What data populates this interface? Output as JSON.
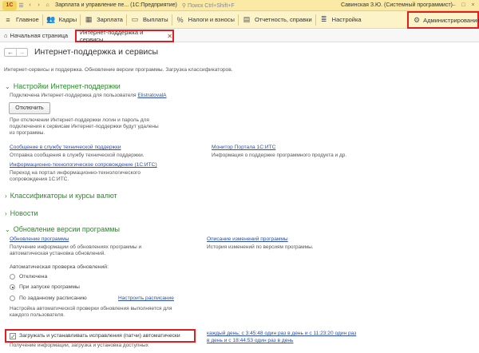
{
  "window": {
    "title": "Зарплата и управление пе... (1С:Предприятие)",
    "search_hint": "Поиск Ctrl+Shift+F",
    "user": "Савинская З.Ю. (Системный программист)",
    "logo": "1С"
  },
  "sections": [
    "Главное",
    "Кадры",
    "Зарплата",
    "Выплаты",
    "Налоги и взносы",
    "Отчетность, справки",
    "Настройка",
    "Администрирование"
  ],
  "tabs": {
    "home": "Начальная страница",
    "active": "Интернет-поддержка и сервисы"
  },
  "page": {
    "title": "Интернет-поддержка и сервисы",
    "description": "Интернет-сервисы и поддержка. Обновление версии программы. Загрузка классификаторов.",
    "isp": {
      "group": "Настройки Интернет-поддержки",
      "connected_text": "Подключена Интернет-поддержка для пользователя",
      "user": "ElistratovalA",
      "disconnect_button": "Отключить",
      "note_lines": [
        "При отключении Интернет-поддержки логин и пароль для",
        "подключения к сервисам Интернет-поддержки будут удалены",
        "из программы."
      ]
    },
    "support_link": "Сообщение в службу технической поддержки",
    "support_desc": "Отправка сообщения в службу технической поддержки.",
    "its_link": "Информационно-технологическое сопровождение (1С:ИТС)",
    "its_desc_lines": [
      "Переход на портал информационно-технологического",
      "сопровождения 1С:ИТС."
    ],
    "monitor_link": "Монитор Портала 1С:ИТС",
    "monitor_desc": "Информация о поддержке программного продукта и др.",
    "classifiers_group": "Классификаторы и курсы валют",
    "news_group": "Новости",
    "update": {
      "group": "Обновление версии программы",
      "update_link": "Обновление программы",
      "update_desc_lines": [
        "Получение информации об обновлениях программы и",
        "автоматическая установка обновлений."
      ],
      "changes_link": "Описание изменений программы",
      "changes_desc": "История изменений по версиям программы.",
      "auto_check_label": "Автоматическая проверка обновлений:",
      "options": [
        "Отключена",
        "При запуске программы",
        "По заданному расписанию"
      ],
      "selected_option": "При запуске программы",
      "schedule_link": "Настроить расписание",
      "schedule_note_lines": [
        "Настройка автоматической проверки обновления выполняется для",
        "каждого пользователя."
      ],
      "patches_label": "Загружать и устанавливать исправления (патчи) автоматически",
      "patches_checked": true,
      "patches_note": "Получение информации, загрузка и установка доступных",
      "patch_schedule_lines": [
        "каждый день; с 3:45:48 один раз в день и с 11:23:20 один раз",
        "в день и с 18:44:53 один раз в день"
      ]
    }
  }
}
